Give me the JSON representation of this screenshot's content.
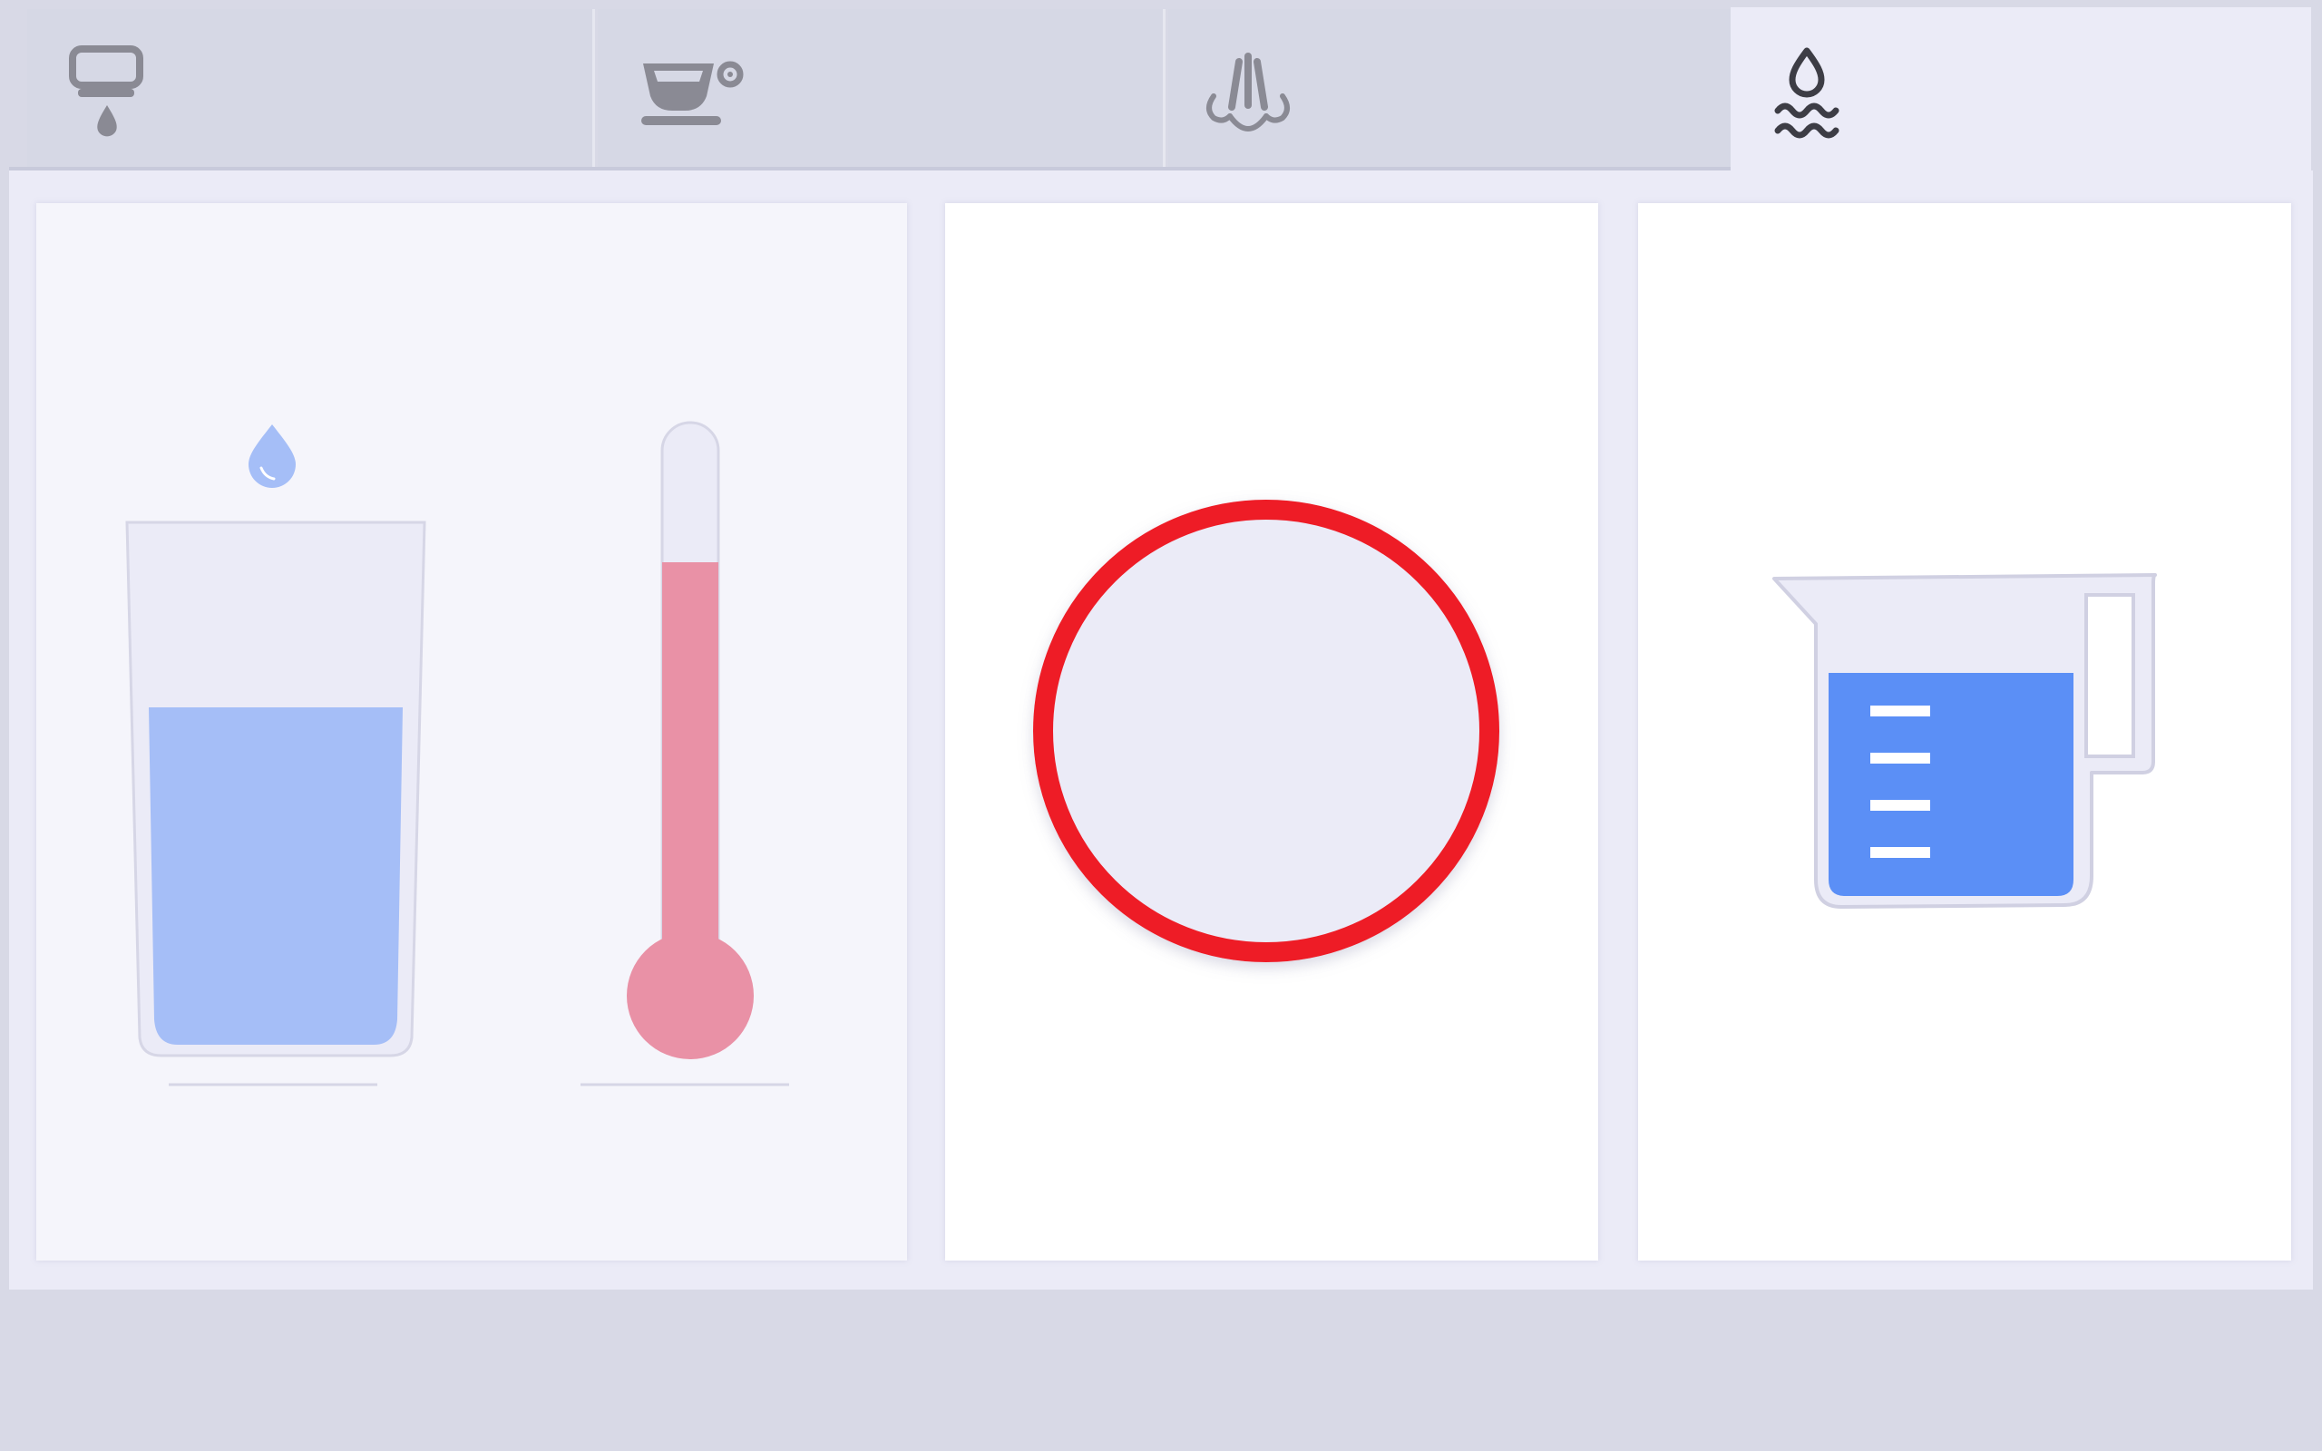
{
  "colors": {
    "background": "#d8d9e6",
    "tab_inactive": "#d6d8e5",
    "tab_active": "#ebebf7",
    "icon_inactive": "#8a8a94",
    "icon_active": "#3d3d45",
    "water_light": "#a5bef7",
    "water_dark": "#5b8ff6",
    "thermo_fill": "#e991a6",
    "record_ring": "#ee1c25",
    "record_center": "#ebebf7"
  },
  "tabs": [
    {
      "icon": "dispenser-drip-icon",
      "active": false
    },
    {
      "icon": "coffee-cup-icon",
      "active": false
    },
    {
      "icon": "steam-icon",
      "active": false
    },
    {
      "icon": "hot-water-icon",
      "active": true
    }
  ],
  "panels": {
    "water_settings": {
      "glass_fill_level": 0.6,
      "temperature_level": 0.72
    },
    "start_button": {
      "icon": "record-button-icon"
    },
    "jug": {
      "icon": "measuring-jug-icon",
      "fill_level": 0.72
    }
  }
}
